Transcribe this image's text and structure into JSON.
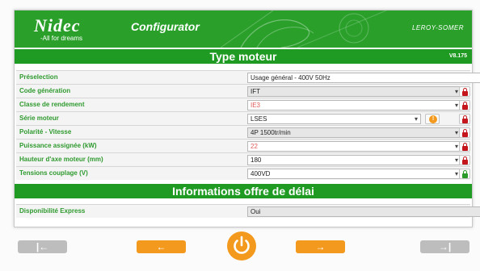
{
  "header": {
    "logo": "Nidec",
    "tagline": "-All for dreams",
    "app_title": "Configurator",
    "brand": "LEROY-SOMER"
  },
  "section1": {
    "title": "Type moteur",
    "version": "V8.175"
  },
  "rows": [
    {
      "label": "Préselection",
      "value": "Usage général - 400V 50Hz"
    },
    {
      "label": "Code génération",
      "value": "IFT"
    },
    {
      "label": "Classe de rendement",
      "value": "IE3"
    },
    {
      "label": "Série moteur",
      "value": "LSES"
    },
    {
      "label": "Polarité - Vitesse",
      "value": "4P 1500tr/min"
    },
    {
      "label": "Puissance assignée (kW)",
      "value": "22"
    },
    {
      "label": "Hauteur d'axe moteur (mm)",
      "value": "180"
    },
    {
      "label": "Tensions couplage (V)",
      "value": "400VD"
    }
  ],
  "section2": {
    "title": "Informations offre de délai"
  },
  "express": {
    "label": "Disponibilité Express",
    "value": "Oui"
  },
  "nav": {
    "first": "|←",
    "prev": "←",
    "next": "→",
    "last": "→|"
  },
  "icons": {
    "lock": "lock-icon",
    "warning": "warning-icon",
    "power": "power-icon"
  },
  "colors": {
    "green": "#2aa02b",
    "orange": "#f39a1e",
    "red_lock": "#c4161c",
    "red_text": "#e05a5a"
  }
}
